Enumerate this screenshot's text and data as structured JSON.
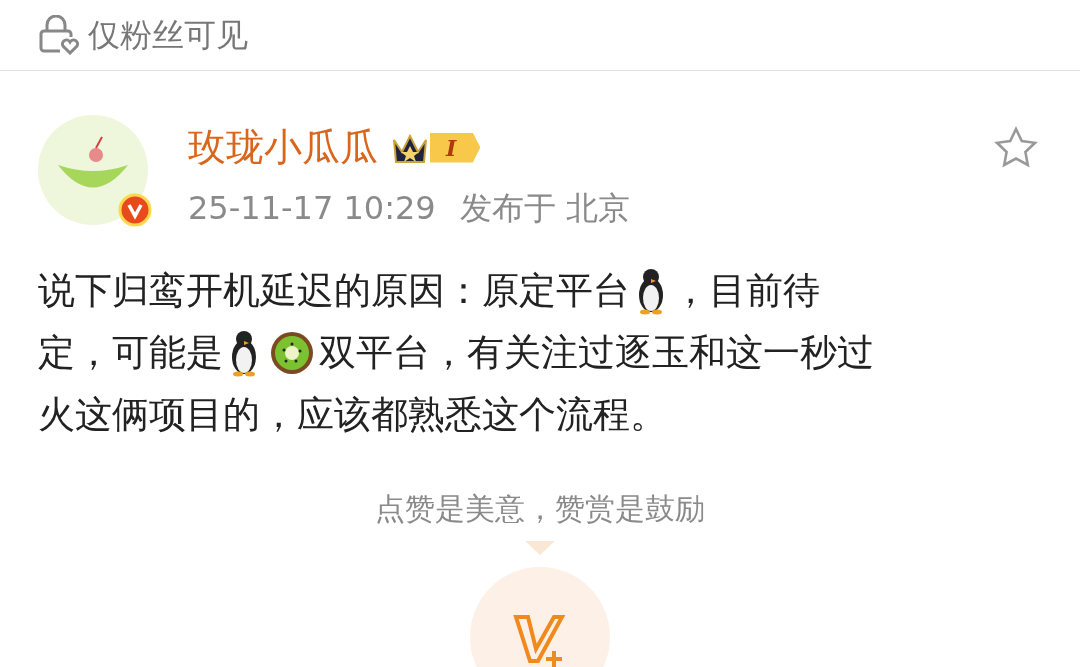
{
  "visibility": {
    "label": "仅粉丝可见"
  },
  "post": {
    "author": {
      "name": "玫珑小瓜瓜",
      "level_badge": "I",
      "verified": true
    },
    "meta": {
      "time": "25-11-17 10:29",
      "location": "发布于 北京"
    },
    "favorited": false,
    "body_lines": [
      [
        {
          "kind": "text",
          "text": "说下归鸾开机延迟的原因：原定平台"
        },
        {
          "kind": "penguin"
        },
        {
          "kind": "text",
          "text": "，目前待"
        }
      ],
      [
        {
          "kind": "text",
          "text": "定，可能是"
        },
        {
          "kind": "penguin"
        },
        {
          "kind": "kiwi"
        },
        {
          "kind": "text",
          "text": "双平台，有关注过逐玉和这一秒过"
        }
      ],
      [
        {
          "kind": "text",
          "text": "火这俩项目的，应该都熟悉这个流程。"
        }
      ]
    ]
  },
  "reward": {
    "prompt": "点赞是美意，赞赏是鼓励"
  }
}
